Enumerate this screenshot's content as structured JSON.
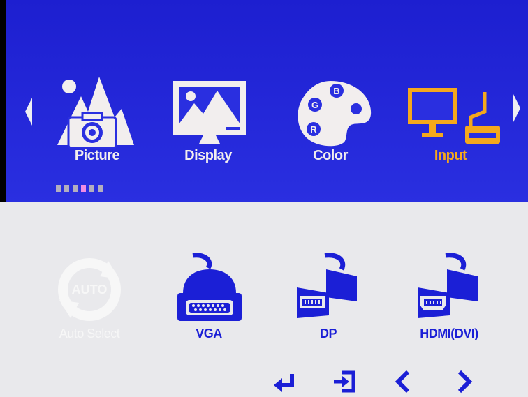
{
  "menu": {
    "items": [
      {
        "label": "Picture",
        "icon": "picture-icon"
      },
      {
        "label": "Display",
        "icon": "display-icon"
      },
      {
        "label": "Color",
        "icon": "color-palette-icon"
      },
      {
        "label": "Input",
        "icon": "input-monitor-icon",
        "selected": true
      }
    ],
    "page_dots": {
      "count": 6,
      "active_index": 3
    }
  },
  "input_sources": [
    {
      "label": "Auto Select",
      "icon": "auto-select-icon",
      "badge": "AUTO",
      "enabled": false
    },
    {
      "label": "VGA",
      "icon": "vga-connector-icon",
      "enabled": true
    },
    {
      "label": "DP",
      "icon": "displayport-connector-icon",
      "enabled": true
    },
    {
      "label": "HDMI(DVI)",
      "icon": "hdmi-connector-icon",
      "enabled": true
    }
  ],
  "palette_letters": [
    "B",
    "G",
    "R"
  ],
  "key_hints": [
    "enter-icon",
    "exit-icon",
    "left-icon",
    "right-icon"
  ],
  "colors": {
    "header_blue": "#2a2fe0",
    "selected_orange": "#f5a81c",
    "icon_white": "#f2eeee",
    "connector_blue": "#1b1fd6",
    "panel_gray": "#e9e9ec",
    "active_dot": "#f08ce4"
  }
}
